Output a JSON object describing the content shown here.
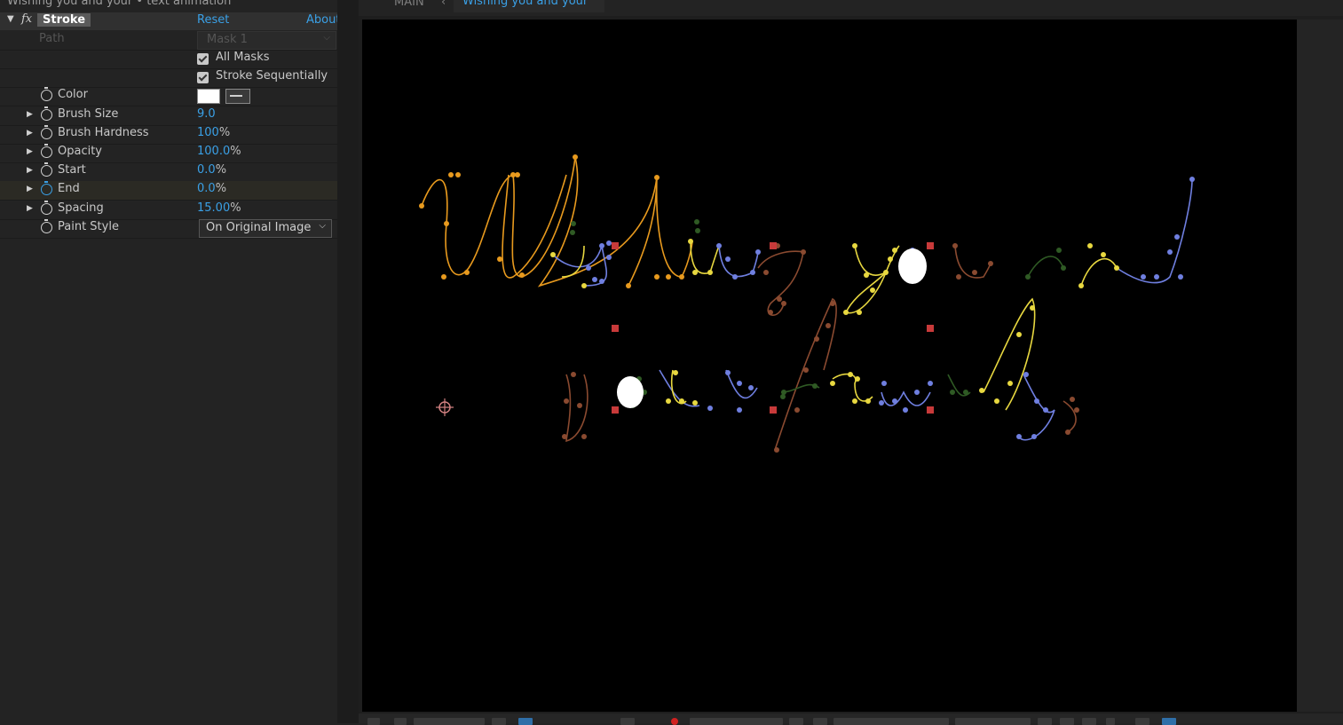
{
  "window": {
    "panel_title": "Wishing you and your • text animation"
  },
  "effect": {
    "name": "Stroke",
    "reset_label": "Reset",
    "about_label": "About",
    "path": {
      "label": "Path",
      "value": "Mask 1"
    },
    "all_masks": {
      "label": "All Masks",
      "checked": true
    },
    "stroke_sequentially": {
      "label": "Stroke Sequentially",
      "checked": true
    },
    "color": {
      "label": "Color",
      "value": "#ffffff"
    },
    "brush_size": {
      "label": "Brush Size",
      "value": "9.0"
    },
    "brush_hardness": {
      "label": "Brush Hardness",
      "value": "100",
      "unit": "%"
    },
    "opacity": {
      "label": "Opacity",
      "value": "100.0",
      "unit": "%"
    },
    "start": {
      "label": "Start",
      "value": "0.0",
      "unit": "%"
    },
    "end": {
      "label": "End",
      "value": "0.0",
      "unit": "%"
    },
    "spacing": {
      "label": "Spacing",
      "value": "15.00",
      "unit": "%"
    },
    "paint_style": {
      "label": "Paint Style",
      "value": "On Original Image"
    }
  },
  "viewer": {
    "tabs": {
      "main": "MAIN",
      "active": "Wishing you and your"
    },
    "canvas_text": "Wishing you and your family",
    "mask_colors": [
      "#e89a1e",
      "#6f7fe0",
      "#e8d840",
      "#8a4a30",
      "#2f5a24"
    ]
  }
}
